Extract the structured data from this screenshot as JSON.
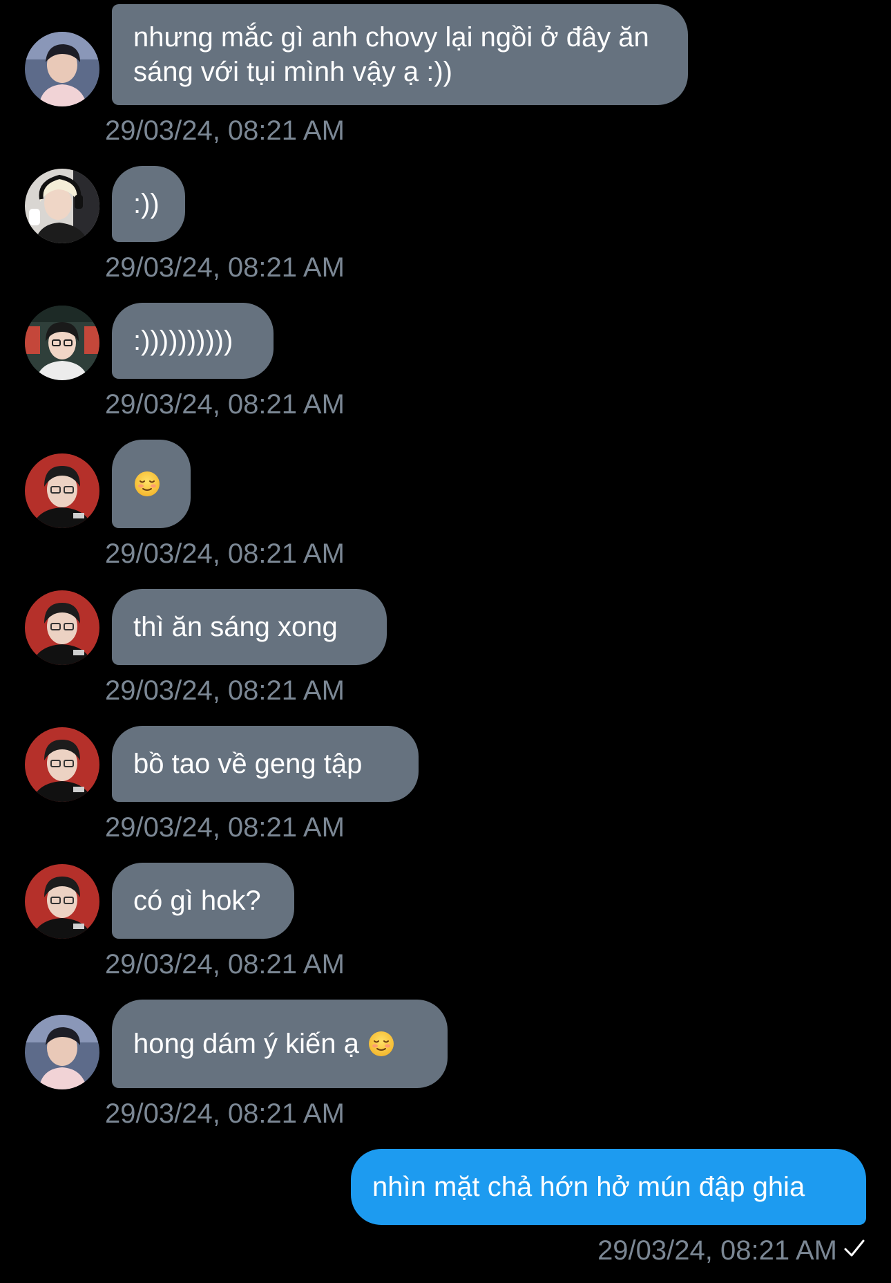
{
  "messages": [
    {
      "sender": "user-a",
      "text": "nhưng mắc gì anh chovy lại ngồi ở đây ăn sáng với tụi mình vậy ạ :))",
      "time": "29/03/24, 08:21 AM"
    },
    {
      "sender": "user-b",
      "text": ":))",
      "time": "29/03/24, 08:21 AM"
    },
    {
      "sender": "user-c",
      "text": ":))))))))))",
      "time": "29/03/24, 08:21 AM"
    },
    {
      "sender": "user-d",
      "text": "☺️",
      "time": "29/03/24, 08:21 AM"
    },
    {
      "sender": "user-d",
      "text": "thì ăn sáng xong",
      "time": "29/03/24, 08:21 AM"
    },
    {
      "sender": "user-d",
      "text": "bồ tao về geng tập",
      "time": "29/03/24, 08:21 AM"
    },
    {
      "sender": "user-d",
      "text": "có gì hok?",
      "time": "29/03/24, 08:21 AM"
    },
    {
      "sender": "user-a",
      "text": "hong dám ý kiến ạ",
      "emoji": "☺️",
      "time": "29/03/24, 08:21 AM"
    },
    {
      "sender": "me",
      "text": "nhìn mặt chả hớn hở mún đập ghia",
      "time": "29/03/24, 08:21 AM",
      "status": "sent-check-icon"
    }
  ],
  "colors": {
    "background": "#000000",
    "incoming_bubble": "#66727f",
    "outgoing_bubble": "#1d9bf0",
    "timestamp": "#7b8794"
  }
}
